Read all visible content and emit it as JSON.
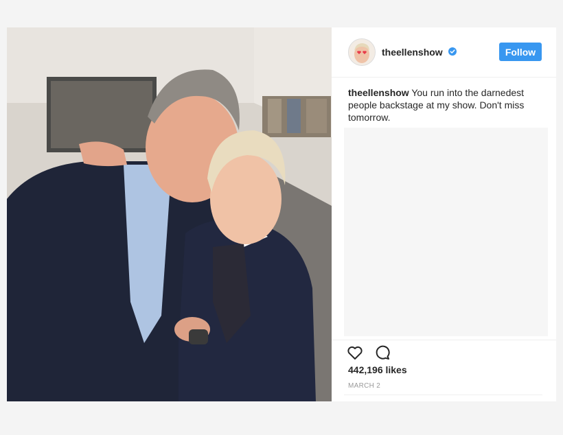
{
  "post": {
    "username": "theellenshow",
    "follow_label": "Follow",
    "caption_user": "theellenshow",
    "caption_text": "You run into the darnedest people backstage at my show. Don't miss tomorrow.",
    "likes": "442,196 likes",
    "date": "MARCH 2"
  },
  "icons": {
    "avatar": "avatar-image",
    "verified": "verified-badge-icon",
    "like": "heart-icon",
    "comment": "comment-bubble-icon"
  },
  "colors": {
    "accent": "#3897f0",
    "text": "#262626",
    "muted": "#999999",
    "panel_bg": "#ffffff",
    "page_bg": "#f4f4f4"
  }
}
